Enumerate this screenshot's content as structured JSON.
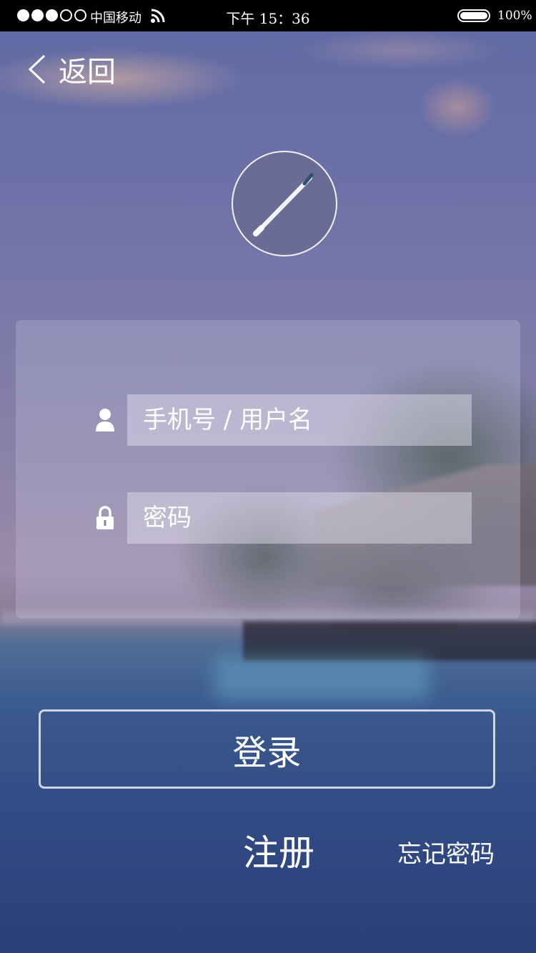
{
  "status_bar": {
    "carrier": "中国移动",
    "time": "下午 15：36",
    "battery": "100%",
    "signal_bars_filled": 3,
    "signal_bars_total": 5,
    "battery_level": 1.0
  },
  "nav": {
    "back_label": "返回",
    "back_icon": "chevron-left-icon"
  },
  "logo": {
    "icon": "pen-icon"
  },
  "form": {
    "username": {
      "placeholder": "手机号 / 用户名",
      "value": "",
      "icon": "user-icon"
    },
    "password": {
      "placeholder": "密码",
      "value": "",
      "icon": "lock-icon"
    }
  },
  "actions": {
    "login_label": "登录",
    "register_label": "注册",
    "forgot_label": "忘记密码"
  },
  "colors": {
    "text": "#ffffff",
    "status_bar_bg": "#000000"
  }
}
